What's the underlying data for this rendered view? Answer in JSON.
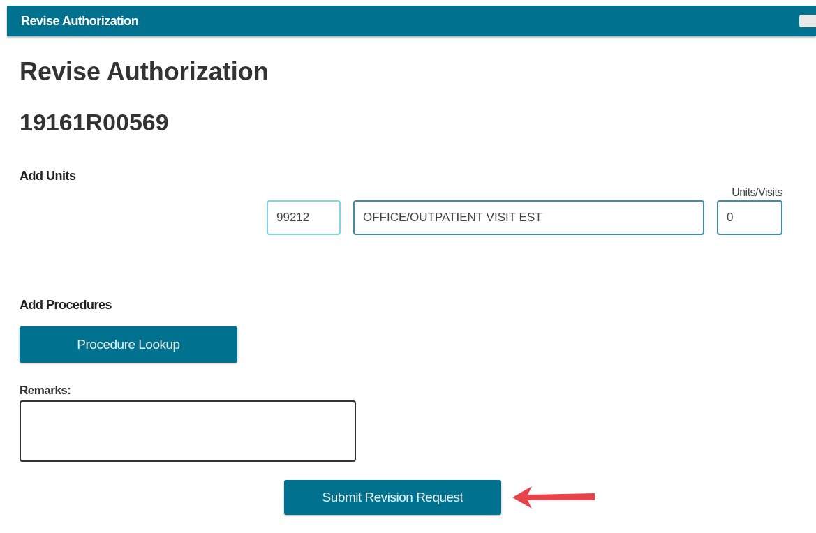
{
  "header": {
    "title": "Revise Authorization"
  },
  "page_title": "Revise Authorization",
  "auth_number": "19161R00569",
  "add_units": {
    "heading": "Add Units",
    "code": "99212",
    "description": "OFFICE/OUTPATIENT VISIT EST",
    "units_label": "Units/Visits",
    "units": "0"
  },
  "add_procedures": {
    "heading": "Add Procedures",
    "lookup_button": "Procedure Lookup"
  },
  "remarks": {
    "label": "Remarks:"
  },
  "submit_button": "Submit Revision Request"
}
